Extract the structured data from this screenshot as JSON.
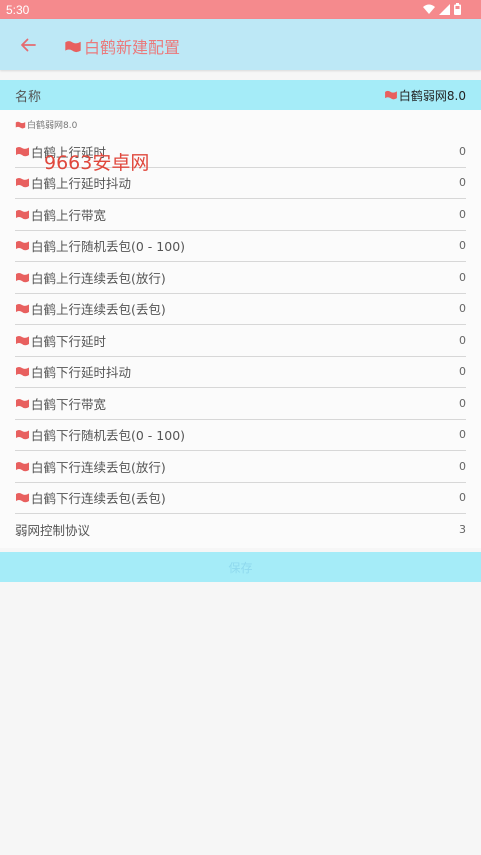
{
  "status_bar": {
    "time": "5:30",
    "icons": [
      "wifi-icon",
      "signal-icon",
      "battery-icon"
    ]
  },
  "app_bar": {
    "back_icon": "arrow-left-icon",
    "flag_icon": "flag-icon",
    "title": "白鹤新建配置"
  },
  "name_field": {
    "label": "名称",
    "value": "白鹤弱网8.0"
  },
  "config": {
    "subtitle": "白鹤弱网8.0",
    "params": [
      {
        "name": "白鹤上行延时",
        "value": "0"
      },
      {
        "name": "白鹤上行延时抖动",
        "value": "0"
      },
      {
        "name": "白鹤上行带宽",
        "value": "0"
      },
      {
        "name": "白鹤上行随机丢包(0 - 100)",
        "value": "0"
      },
      {
        "name": "白鹤上行连续丢包(放行)",
        "value": "0"
      },
      {
        "name": "白鹤上行连续丢包(丢包)",
        "value": "0"
      },
      {
        "name": "白鹤下行延时",
        "value": "0"
      },
      {
        "name": "白鹤下行延时抖动",
        "value": "0"
      },
      {
        "name": "白鹤下行带宽",
        "value": "0"
      },
      {
        "name": "白鹤下行随机丢包(0 - 100)",
        "value": "0"
      },
      {
        "name": "白鹤下行连续丢包(放行)",
        "value": "0"
      },
      {
        "name": "白鹤下行连续丢包(丢包)",
        "value": "0"
      }
    ],
    "protocol": {
      "name": "弱网控制协议",
      "value": "3"
    }
  },
  "watermark": "9663安卓网",
  "save_button": "保存",
  "colors": {
    "status_bar": "#f58a8d",
    "app_bar": "#bde8f6",
    "accent_cyan": "#a5ecf8",
    "title_pink": "#ea7a7c",
    "flag_red": "#e8605f",
    "watermark_red": "#e0473c"
  }
}
